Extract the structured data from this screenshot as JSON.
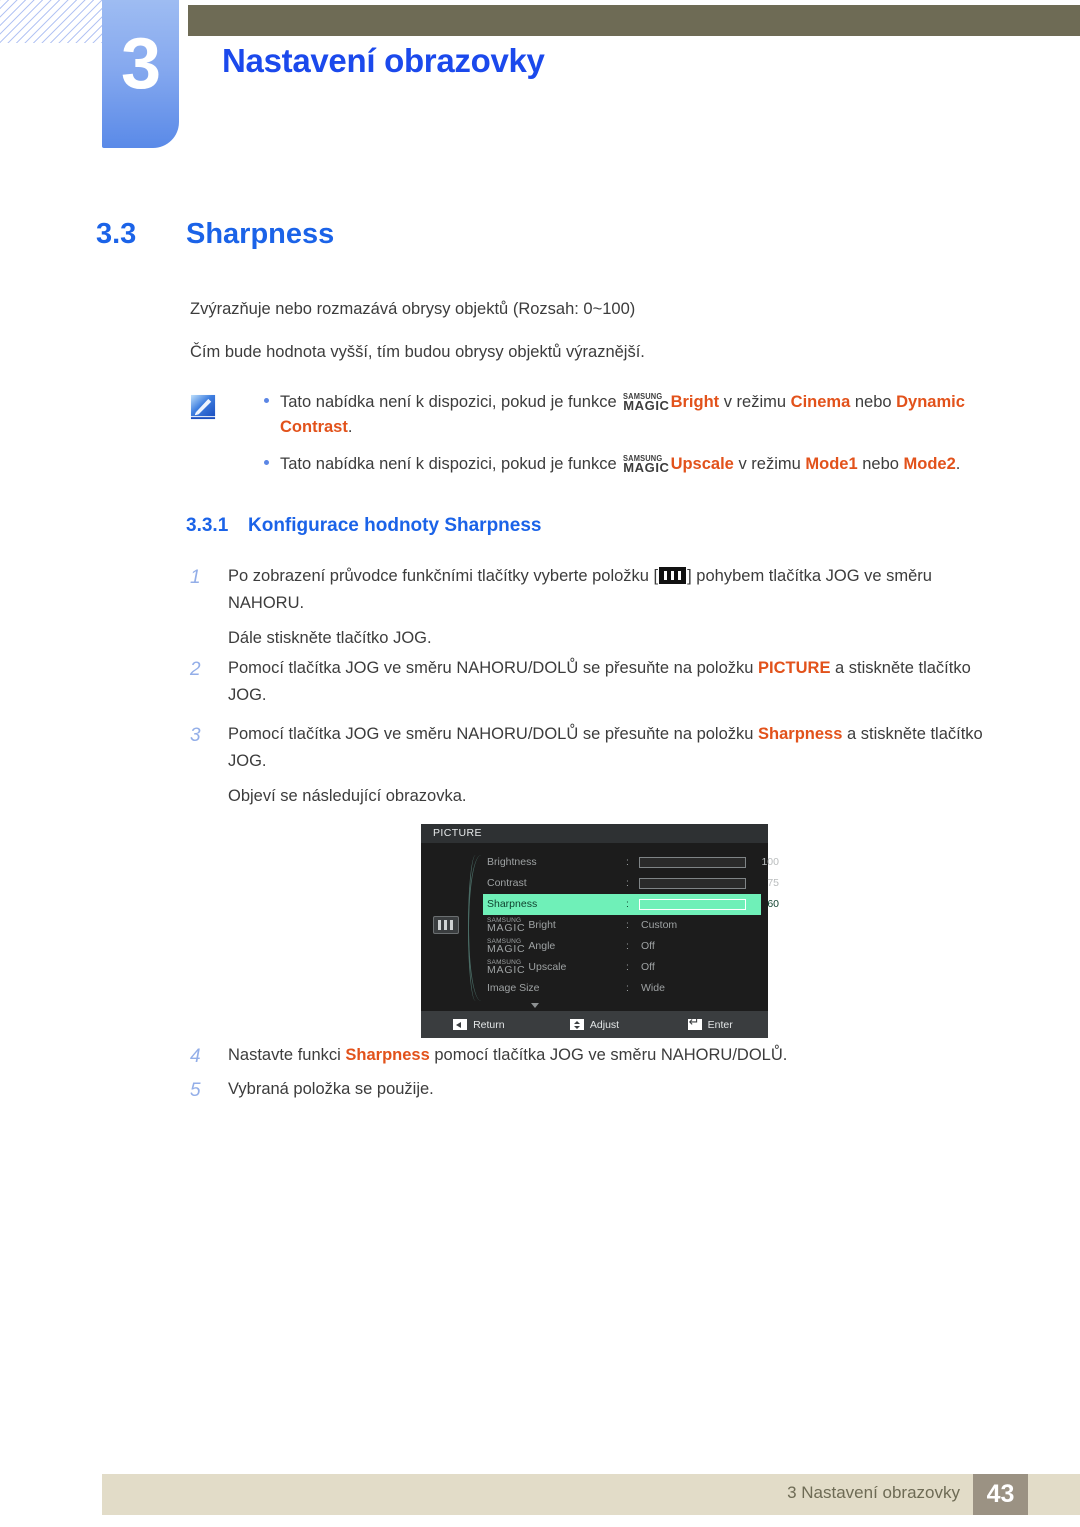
{
  "header": {
    "chapter_number": "3",
    "chapter_title": "Nastavení obrazovky"
  },
  "section": {
    "number": "3.3",
    "title": "Sharpness"
  },
  "paragraphs": {
    "p1": "Zvýrazňuje nebo rozmazává obrysy objektů (Rozsah: 0~100)",
    "p2": "Čím bude hodnota vyšší, tím budou obrysy objektů výraznější."
  },
  "note": {
    "icon_name": "note-pencil-icon",
    "items": [
      {
        "t1": "Tato nabídka není k dispozici, pokud je funkce ",
        "magic_top": "SAMSUNG",
        "magic_bottom": "MAGIC",
        "feature": "Bright",
        "t2": " v režimu ",
        "mode1": "Cinema",
        "t3": " nebo ",
        "mode2": "Dynamic Contrast",
        "t4": "."
      },
      {
        "t1": "Tato nabídka není k dispozici, pokud je funkce ",
        "magic_top": "SAMSUNG",
        "magic_bottom": "MAGIC",
        "feature": "Upscale",
        "t2": " v režimu ",
        "mode1": "Mode1",
        "t3": " nebo ",
        "mode2": "Mode2",
        "t4": "."
      }
    ]
  },
  "subsection": {
    "number": "3.3.1",
    "title": "Konfigurace hodnoty Sharpness"
  },
  "steps": [
    {
      "num": "1",
      "text_before": "Po zobrazení průvodce funkčními tlačítky vyberte položku [",
      "glyph": "menu-bars-icon",
      "text_after": "] pohybem tlačítka JOG ve směru NAHORU.",
      "sub": "Dále stiskněte tlačítko JOG."
    },
    {
      "num": "2",
      "text_before": "Pomocí tlačítka JOG ve směru NAHORU/DOLŮ se přesuňte na položku ",
      "highlight": "PICTURE",
      "text_after": " a stiskněte tlačítko JOG.",
      "sub": ""
    },
    {
      "num": "3",
      "text_before": "Pomocí tlačítka JOG ve směru NAHORU/DOLŮ se přesuňte na položku ",
      "highlight": "Sharpness",
      "text_after": " a stiskněte tlačítko JOG.",
      "sub": "Objeví se následující obrazovka."
    },
    {
      "num": "4",
      "text_before": "Nastavte funkci ",
      "highlight": "Sharpness",
      "text_after": " pomocí tlačítka JOG ve směru NAHORU/DOLŮ.",
      "sub": ""
    },
    {
      "num": "5",
      "text_before": "Vybraná položka se použije.",
      "highlight": "",
      "text_after": "",
      "sub": ""
    }
  ],
  "osd": {
    "title": "PICTURE",
    "side_icon": "menu-bars-icon",
    "scroll_indicator": "chevron-down-icon",
    "rows": [
      {
        "label": "Brightness",
        "colon": ":",
        "type": "slider",
        "value": "100",
        "percent": 100
      },
      {
        "label": "Contrast",
        "colon": ":",
        "type": "slider",
        "value": "75",
        "percent": 75
      },
      {
        "label": "Sharpness",
        "colon": ":",
        "type": "slider",
        "value": "60",
        "percent": 60,
        "selected": true
      },
      {
        "magic_top": "SAMSUNG",
        "magic_bottom": "MAGIC",
        "label": "Bright",
        "colon": ":",
        "type": "value",
        "value": "Custom"
      },
      {
        "magic_top": "SAMSUNG",
        "magic_bottom": "MAGIC",
        "label": "Angle",
        "colon": ":",
        "type": "value",
        "value": "Off"
      },
      {
        "magic_top": "SAMSUNG",
        "magic_bottom": "MAGIC",
        "label": "Upscale",
        "colon": ":",
        "type": "value",
        "value": "Off"
      },
      {
        "label": "Image Size",
        "colon": ":",
        "type": "value",
        "value": "Wide"
      }
    ],
    "footer": [
      {
        "icon": "arrow-left-icon",
        "label": "Return"
      },
      {
        "icon": "arrow-updown-icon",
        "label": "Adjust"
      },
      {
        "icon": "enter-key-icon",
        "label": "Enter"
      }
    ],
    "colors": {
      "highlight": "#6ff0b8",
      "selected_label": "#46e3a4",
      "background": "#1c1c1c",
      "title_bar": "#2e3133"
    }
  },
  "footer": {
    "text": "3 Nastavení obrazovky",
    "page": "43"
  },
  "theme": {
    "heading_blue": "#1b63e8",
    "title_blue": "#1b49ec",
    "accent_orange": "#e2521b",
    "olive": "#6e6b55",
    "footer_bar": "#e2dcc8"
  }
}
